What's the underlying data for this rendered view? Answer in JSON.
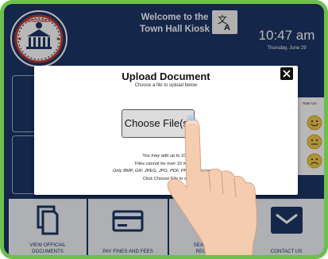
{
  "header": {
    "seal_text": "GOVERNMENT",
    "welcome_line1": "Welcome to the",
    "welcome_line2": "Town Hall Kiosk",
    "time": "10:47 am",
    "date": "Thursday, June 29"
  },
  "tiles": [
    {
      "label_line1": "VIEW OFFICIAL",
      "label_line2": "DOCUMENTS",
      "icon": "documents-icon"
    },
    {
      "label_line1": "PAY FINES AND FEES",
      "label_line2": "",
      "icon": "credit-card-icon"
    },
    {
      "label_line1": "SEARCH ON",
      "label_line2": "RECORDS",
      "icon": "search-icon"
    },
    {
      "label_line1": "CONTACT US",
      "label_line2": "",
      "icon": "envelope-icon"
    }
  ],
  "rating_panel": {
    "title": "Rate Us!",
    "faces": [
      "happy-face-icon",
      "neutral-face-icon",
      "sad-face-icon"
    ]
  },
  "modal": {
    "title": "Upload Document",
    "subtitle": "Choose a file to upload below",
    "choose_button": "Choose File(s)",
    "info_line1": "You may add up to 10 fi",
    "info_line2": "Files cannot be over 10 megab",
    "info_line3": "Only BMP, GIF, JPEG, JPG, PDF, PNG are accepted.",
    "info_line4": "Click Choose File to se"
  },
  "colors": {
    "frame": "#6dc04b",
    "navy": "#1d3566",
    "accent_yellow": "#f2c94c"
  }
}
